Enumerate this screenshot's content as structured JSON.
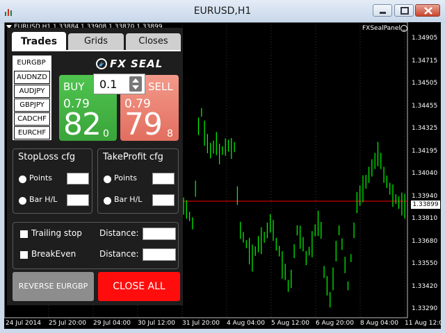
{
  "window": {
    "title": "EURUSD,H1"
  },
  "chart": {
    "ohlc_label": "EURUSD,H1  1.33884 1.33908 1.33870 1.33899",
    "panel_name": "FXSealPanel",
    "current_price": "1.33899",
    "y_ticks": [
      "1.34905",
      "1.34715",
      "1.34505",
      "1.34455",
      "1.34325",
      "1.34195",
      "1.34040",
      "1.33940",
      "1.33810",
      "1.33680",
      "1.33550",
      "1.33420",
      "1.33290"
    ],
    "x_ticks": [
      "24 Jul 2014",
      "25 Jul 20:00",
      "29 Jul 04:00",
      "30 Jul 12:00",
      "31 Jul 20:00",
      "4 Aug 04:00",
      "5 Aug 12:00",
      "6 Aug 20:00",
      "8 Aug 04:00",
      "11 Aug 12:00"
    ],
    "colors": {
      "background": "#000000",
      "candles": "#00ff00",
      "price_line": "#ff0000",
      "grid": "#3a3a3a"
    }
  },
  "panel": {
    "tabs": [
      {
        "label": "Trades",
        "active": true
      },
      {
        "label": "Grids",
        "active": false
      },
      {
        "label": "Closes",
        "active": false
      }
    ],
    "symbols": [
      "EURGBP",
      "AUDNZD",
      "AUDJPY",
      "GBPJPY",
      "CADCHF",
      "EURCHF"
    ],
    "logo": "FX SEAL",
    "buy": {
      "label": "BUY",
      "prefix": "0.79",
      "big": "82",
      "small": "0",
      "color": "#3aa43a"
    },
    "sell": {
      "label": "SELL",
      "prefix": "0.79",
      "big": "79",
      "small": "8",
      "color": "#e26e5f"
    },
    "lot": {
      "value": "0.1"
    },
    "stoploss": {
      "title": "StopLoss cfg",
      "options": [
        "Points",
        "Bar H/L"
      ]
    },
    "takeprofit": {
      "title": "TakeProfit cfg",
      "options": [
        "Points",
        "Bar H/L"
      ]
    },
    "trailing": {
      "label": "Trailing stop",
      "distance_label": "Distance:"
    },
    "breakeven": {
      "label": "BreakEven",
      "distance_label": "Distance:"
    },
    "reverse_label": "REVERSE EURGBP",
    "close_all_label": "CLOSE ALL",
    "close_all_color": "#ff0d0d"
  }
}
